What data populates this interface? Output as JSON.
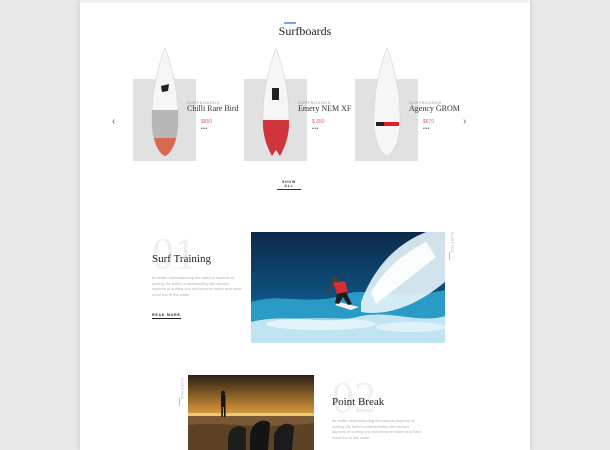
{
  "surfboards": {
    "title": "Surfboards",
    "prev_icon": "chevron-left-icon",
    "next_icon": "chevron-right-icon",
    "products": [
      {
        "category": "SURFBOARDS",
        "name": "Chilli Rare Bird",
        "price": "$850",
        "dots": "•••",
        "bottom_color": "#d8694f"
      },
      {
        "category": "SURFBOARDS",
        "name": "Emery NEM XF",
        "price": "$ 350",
        "dots": "•••",
        "bottom_color": "#d0343c"
      },
      {
        "category": "SURFBOARDS",
        "name": "Agency GROM",
        "price": "$670",
        "dots": "•••",
        "bottom_color": "#e01e2a"
      }
    ],
    "show_all": "SHOW ALL"
  },
  "features": [
    {
      "number": "01",
      "title": "Surf Training",
      "text": "Its better understanding the various aspects of surfing. As better understanding the various aspects of surfing you will become faster and have more fun in the water.",
      "read_more": "READ MORE",
      "side_label": "SURFING"
    },
    {
      "number": "02",
      "title": "Point Break",
      "text": "Its better understanding the various aspects of surfing. As better understanding the various aspects of surfing you will become faster and have more fun in the water.",
      "side_label": "SURFING"
    }
  ],
  "colors": {
    "accent": "#6aa9ff",
    "price": "#e55a7b"
  }
}
